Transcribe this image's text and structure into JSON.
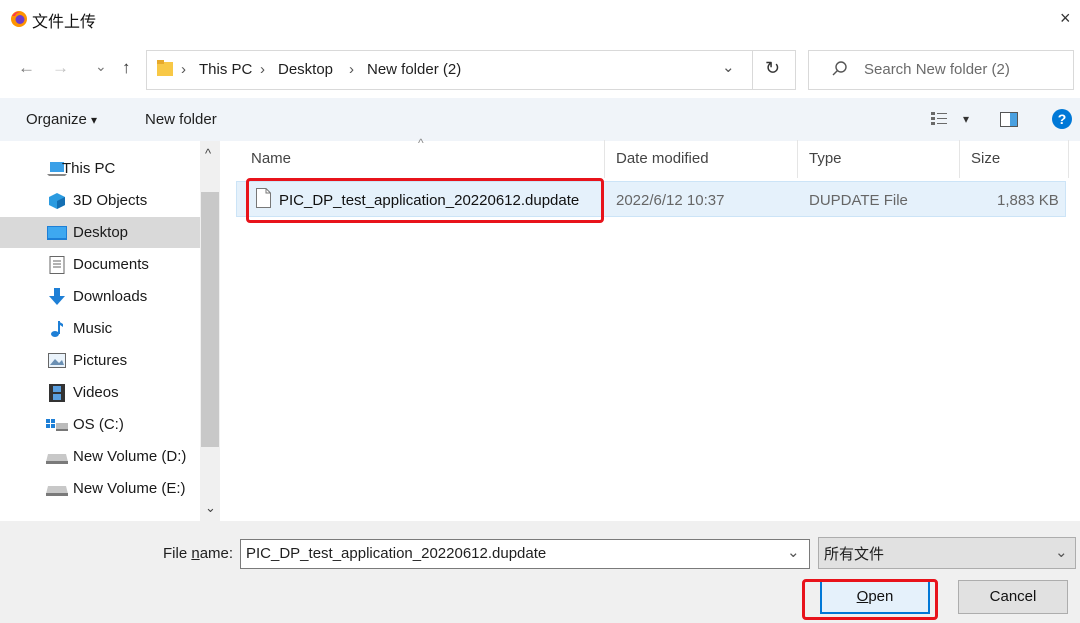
{
  "window": {
    "title": "文件上传",
    "close_glyph": "×"
  },
  "nav": {
    "back": "←",
    "forward": "→",
    "recent": "⌄",
    "up": "↑",
    "address": {
      "crumbs": [
        "This PC",
        "Desktop",
        "New folder (2)"
      ],
      "separator": "›",
      "dropdown": "⌄",
      "refresh": "↻"
    },
    "search": {
      "placeholder": "Search New folder (2)"
    }
  },
  "toolbar": {
    "organize": "Organize",
    "organize_caret": "▾",
    "new_folder": "New folder",
    "view_caret": "▾",
    "help": "?"
  },
  "sidebar": {
    "items": [
      {
        "label": "This PC",
        "icon": "computer-icon"
      },
      {
        "label": "3D Objects",
        "icon": "cube-icon"
      },
      {
        "label": "Desktop",
        "icon": "desktop-icon",
        "selected": true
      },
      {
        "label": "Documents",
        "icon": "document-icon"
      },
      {
        "label": "Downloads",
        "icon": "download-icon"
      },
      {
        "label": "Music",
        "icon": "music-icon"
      },
      {
        "label": "Pictures",
        "icon": "picture-icon"
      },
      {
        "label": "Videos",
        "icon": "video-icon"
      },
      {
        "label": "OS (C:)",
        "icon": "os-drive-icon"
      },
      {
        "label": "New Volume (D:)",
        "icon": "drive-icon"
      },
      {
        "label": "New Volume (E:)",
        "icon": "drive-icon"
      }
    ],
    "scroll_up": "^",
    "scroll_down": "⌄"
  },
  "filelist": {
    "sort_caret": "^",
    "columns": [
      "Name",
      "Date modified",
      "Type",
      "Size"
    ],
    "rows": [
      {
        "name": "PIC_DP_test_application_20220612.dupdate",
        "date": "2022/6/12 10:37",
        "type": "DUPDATE File",
        "size": "1,883 KB"
      }
    ]
  },
  "bottom": {
    "filename_label_pre": "File ",
    "filename_label_u": "n",
    "filename_label_post": "ame:",
    "filename_value": "PIC_DP_test_application_20220612.dupdate",
    "filename_dropdown": "⌄",
    "filetype_value": "所有文件",
    "filetype_dropdown": "⌄",
    "open_u": "O",
    "open_rest": "pen",
    "cancel": "Cancel"
  },
  "colors": {
    "accent": "#0078d7",
    "highlight_box": "#e8131b",
    "selected_row": "#e5f1fb",
    "selected_nav": "#d9d9d9"
  }
}
